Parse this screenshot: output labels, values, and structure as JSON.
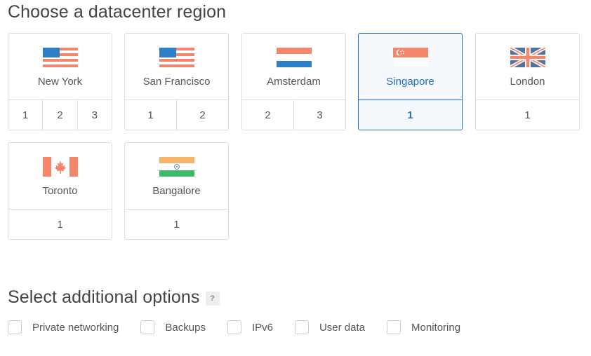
{
  "region_heading": "Choose a datacenter region",
  "options_heading": "Select additional options",
  "help_badge": "?",
  "colors": {
    "accent": "#1f6fbf",
    "flag_red": "#f4876b",
    "flag_blue": "#2c7ec6",
    "border": "#dddddd"
  },
  "regions": [
    {
      "name": "New York",
      "flag": "us-flag-icon",
      "datacenters": [
        "1",
        "2",
        "3"
      ]
    },
    {
      "name": "San Francisco",
      "flag": "us-flag-icon",
      "datacenters": [
        "1",
        "2"
      ]
    },
    {
      "name": "Amsterdam",
      "flag": "netherlands-flag-icon",
      "datacenters": [
        "2",
        "3"
      ]
    },
    {
      "name": "Singapore",
      "flag": "singapore-flag-icon",
      "datacenters": [
        "1"
      ],
      "selected": true
    },
    {
      "name": "London",
      "flag": "uk-flag-icon",
      "datacenters": [
        "1"
      ]
    },
    {
      "name": "Toronto",
      "flag": "canada-flag-icon",
      "datacenters": [
        "1"
      ]
    },
    {
      "name": "Bangalore",
      "flag": "india-flag-icon",
      "datacenters": [
        "1"
      ]
    }
  ],
  "options": [
    {
      "label": "Private networking",
      "checked": false
    },
    {
      "label": "Backups",
      "checked": false
    },
    {
      "label": "IPv6",
      "checked": false
    },
    {
      "label": "User data",
      "checked": false
    },
    {
      "label": "Monitoring",
      "checked": false
    }
  ]
}
